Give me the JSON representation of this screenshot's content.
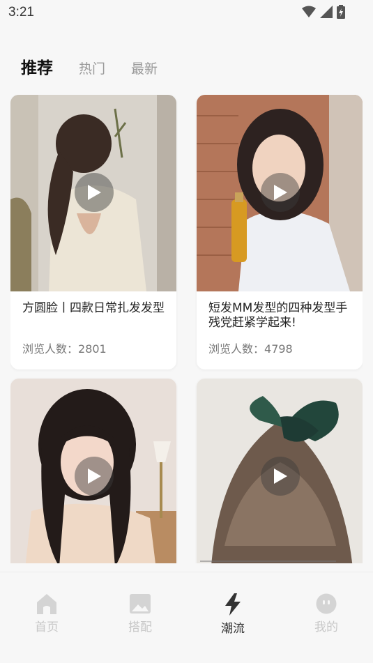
{
  "status_bar": {
    "time": "3:21"
  },
  "tabs": [
    {
      "label": "推荐",
      "active": true
    },
    {
      "label": "热门",
      "active": false
    },
    {
      "label": "最新",
      "active": false
    }
  ],
  "cards": [
    {
      "title": "方圆脸丨四款日常扎发发型",
      "views_label": "浏览人数：",
      "views": "2801"
    },
    {
      "title": "短发MM发型的四种发型手残党赶紧学起来!",
      "views_label": "浏览人数：",
      "views": "4798"
    },
    {
      "title": "",
      "views_label": "",
      "views": ""
    },
    {
      "title": "",
      "views_label": "",
      "views": ""
    }
  ],
  "bottom_nav": [
    {
      "label": "首页",
      "icon": "home-icon",
      "active": false
    },
    {
      "label": "搭配",
      "icon": "image-icon",
      "active": false
    },
    {
      "label": "潮流",
      "icon": "lightning-icon",
      "active": true
    },
    {
      "label": "我的",
      "icon": "face-icon",
      "active": false
    }
  ],
  "colors": {
    "active_text": "#111111",
    "inactive_text": "#9a9a9a",
    "nav_inactive": "#c8c8c8",
    "background": "#f7f7f7"
  }
}
